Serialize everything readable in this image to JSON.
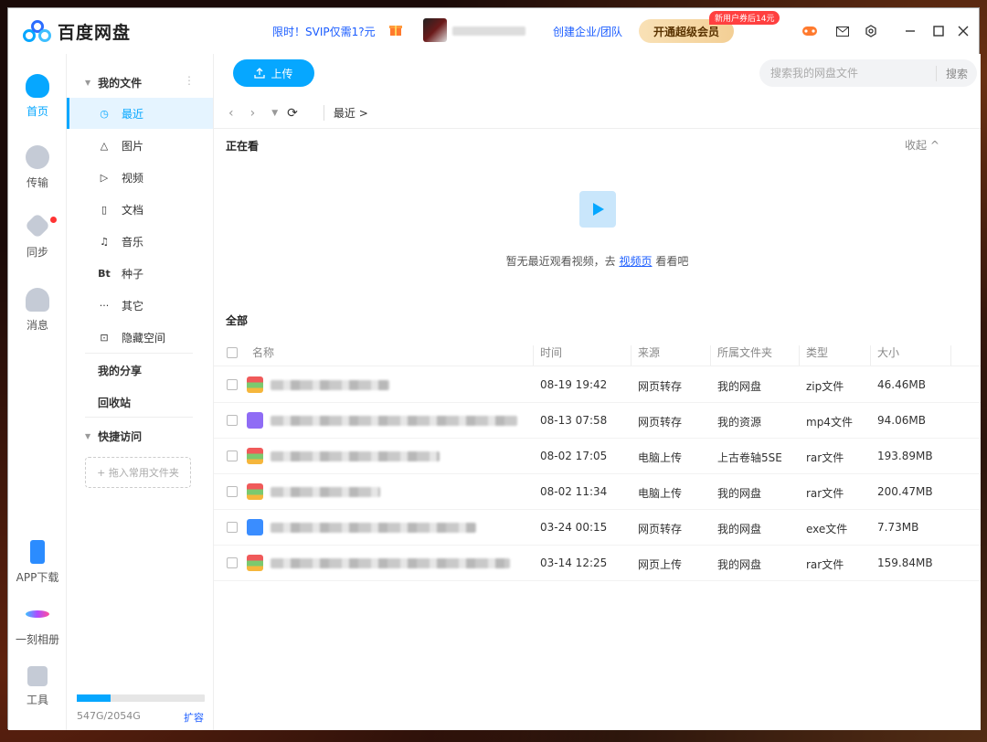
{
  "app": {
    "title": "百度网盘"
  },
  "titlebar": {
    "promo": "限时！SVIP仅需1?元",
    "enterprise": "创建企业/团队",
    "vip_button": "开通超级会员",
    "vip_tag": "新用户券后14元"
  },
  "rail": [
    {
      "label": "首页",
      "icon": "home-cloud-icon",
      "active": true
    },
    {
      "label": "传输",
      "icon": "transfer-icon"
    },
    {
      "label": "同步",
      "icon": "sync-icon"
    },
    {
      "label": "消息",
      "icon": "contacts-icon"
    },
    {
      "label": "APP下载",
      "icon": "phone-icon"
    },
    {
      "label": "一刻相册",
      "icon": "album-icon"
    },
    {
      "label": "工具",
      "icon": "tools-icon"
    }
  ],
  "sidebar": {
    "my_files": "我的文件",
    "items": [
      {
        "label": "最近",
        "icon": "clock-icon",
        "glyph": "◷"
      },
      {
        "label": "图片",
        "icon": "picture-icon",
        "glyph": "△"
      },
      {
        "label": "视频",
        "icon": "video-icon",
        "glyph": "▷"
      },
      {
        "label": "文档",
        "icon": "document-icon",
        "glyph": "▯"
      },
      {
        "label": "音乐",
        "icon": "headphones-icon",
        "glyph": "♫"
      },
      {
        "label": "种子",
        "icon": "bt-icon",
        "glyph": "Bt"
      },
      {
        "label": "其它",
        "icon": "more-icon",
        "glyph": "···"
      },
      {
        "label": "隐藏空间",
        "icon": "lock-icon",
        "glyph": "⊡"
      }
    ],
    "my_share": "我的分享",
    "recycle": "回收站",
    "quick_access": "快捷访问",
    "drag_hint": "+ 拖入常用文件夹",
    "quota": {
      "text": "547G/2054G",
      "used_fraction": 0.266,
      "expand": "扩容"
    }
  },
  "toolbar": {
    "upload": "上传",
    "search_placeholder": "搜索我的网盘文件",
    "search_button": "搜索"
  },
  "breadcrumb": {
    "current": "最近 >"
  },
  "watching": {
    "title": "正在看",
    "collapse": "收起 ^",
    "empty_prefix": "暂无最近观看视频，去",
    "empty_link": "视频页",
    "empty_suffix": "看看吧"
  },
  "all": {
    "title": "全部",
    "columns": [
      "名称",
      "时间",
      "来源",
      "所属文件夹",
      "类型",
      "大小"
    ],
    "rows": [
      {
        "icon": "zip",
        "time": "08-19 19:42",
        "source": "网页转存",
        "folder": "我的网盘",
        "type": "zip文件",
        "size": "46.46MB"
      },
      {
        "icon": "mp4",
        "time": "08-13 07:58",
        "source": "网页转存",
        "folder": "我的资源",
        "type": "mp4文件",
        "size": "94.06MB"
      },
      {
        "icon": "zip",
        "time": "08-02 17:05",
        "source": "电脑上传",
        "folder": "上古卷轴5SE",
        "type": "rar文件",
        "size": "193.89MB"
      },
      {
        "icon": "zip",
        "time": "08-02 11:34",
        "source": "电脑上传",
        "folder": "我的网盘",
        "type": "rar文件",
        "size": "200.47MB"
      },
      {
        "icon": "exe",
        "time": "03-24 00:15",
        "source": "网页转存",
        "folder": "我的网盘",
        "type": "exe文件",
        "size": "7.73MB"
      },
      {
        "icon": "zip",
        "time": "03-14 12:25",
        "source": "网页上传",
        "folder": "我的网盘",
        "type": "rar文件",
        "size": "159.84MB"
      }
    ]
  }
}
